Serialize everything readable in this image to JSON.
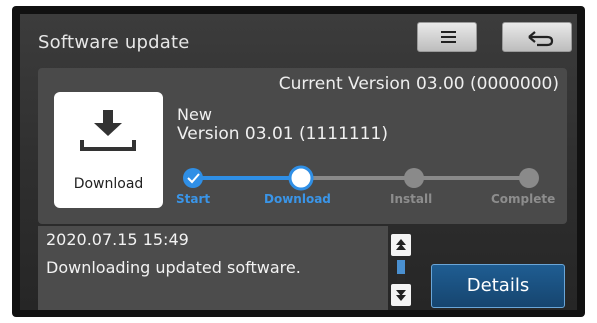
{
  "header": {
    "title": "Software update",
    "menu_icon": "hamburger-menu-icon",
    "back_icon": "back-arrow-icon"
  },
  "update_card": {
    "current_version": "Current Version 03.00 (0000000)",
    "tile_label": "Download",
    "tile_icon": "download-icon",
    "new_label": "New",
    "new_version": "Version 03.01 (1111111)"
  },
  "progress": {
    "steps": [
      {
        "label": "Start",
        "state": "done"
      },
      {
        "label": "Download",
        "state": "current"
      },
      {
        "label": "Install",
        "state": "pending"
      },
      {
        "label": "Complete",
        "state": "pending"
      }
    ],
    "colors": {
      "active": "#2f8fe6",
      "inactive": "#8a8a8a",
      "active_label": "#3a95e8",
      "inactive_label": "#8d8d8d"
    }
  },
  "status": {
    "timestamp": "2020.07.15 15:49",
    "message": "Downloading updated software."
  },
  "buttons": {
    "details": "Details"
  }
}
